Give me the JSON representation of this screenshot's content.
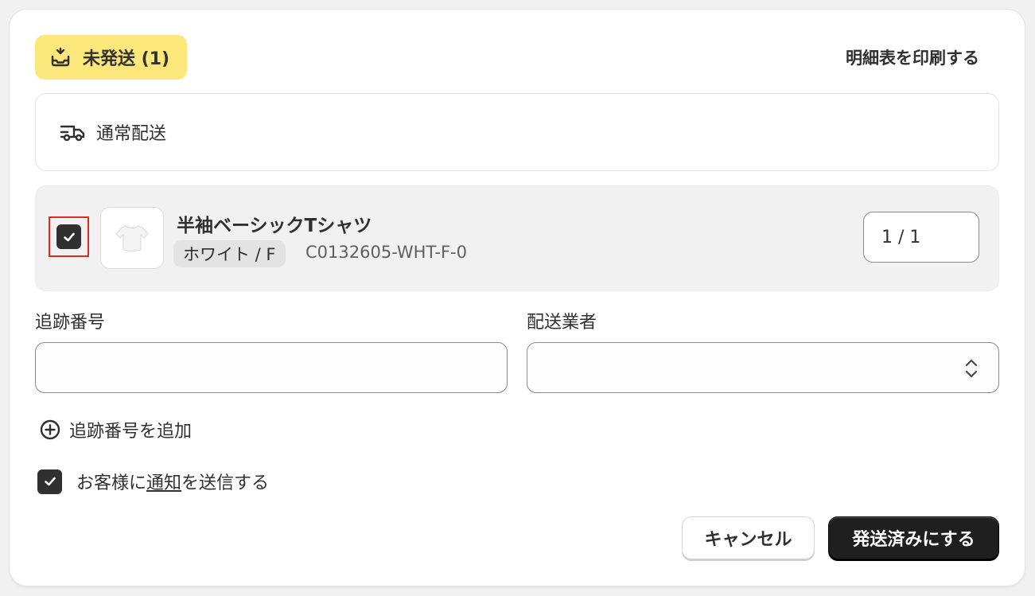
{
  "status": {
    "label": "未発送 (1)",
    "icon": "unfulfilled-box-icon",
    "color": "#fbe77a"
  },
  "header": {
    "print_label": "明細表を印刷する"
  },
  "delivery": {
    "method": "通常配送",
    "icon": "truck-icon"
  },
  "item": {
    "checked": true,
    "title": "半袖ベーシックTシャツ",
    "variant": "ホワイト / F",
    "sku": "C0132605-WHT-F-0",
    "quantity": "1 / 1",
    "image_icon": "tshirt-image"
  },
  "tracking": {
    "label": "追跡番号",
    "value": "",
    "placeholder": ""
  },
  "carrier": {
    "label": "配送業者",
    "value": ""
  },
  "add_tracking_label": "追跡番号を追加",
  "notify": {
    "checked": true,
    "prefix": "お客様に",
    "link": "通知",
    "suffix": "を送信する"
  },
  "buttons": {
    "cancel": "キャンセル",
    "submit": "発送済みにする"
  },
  "colors": {
    "accent": "#1f1f1f",
    "highlight_border": "#d92d20"
  }
}
